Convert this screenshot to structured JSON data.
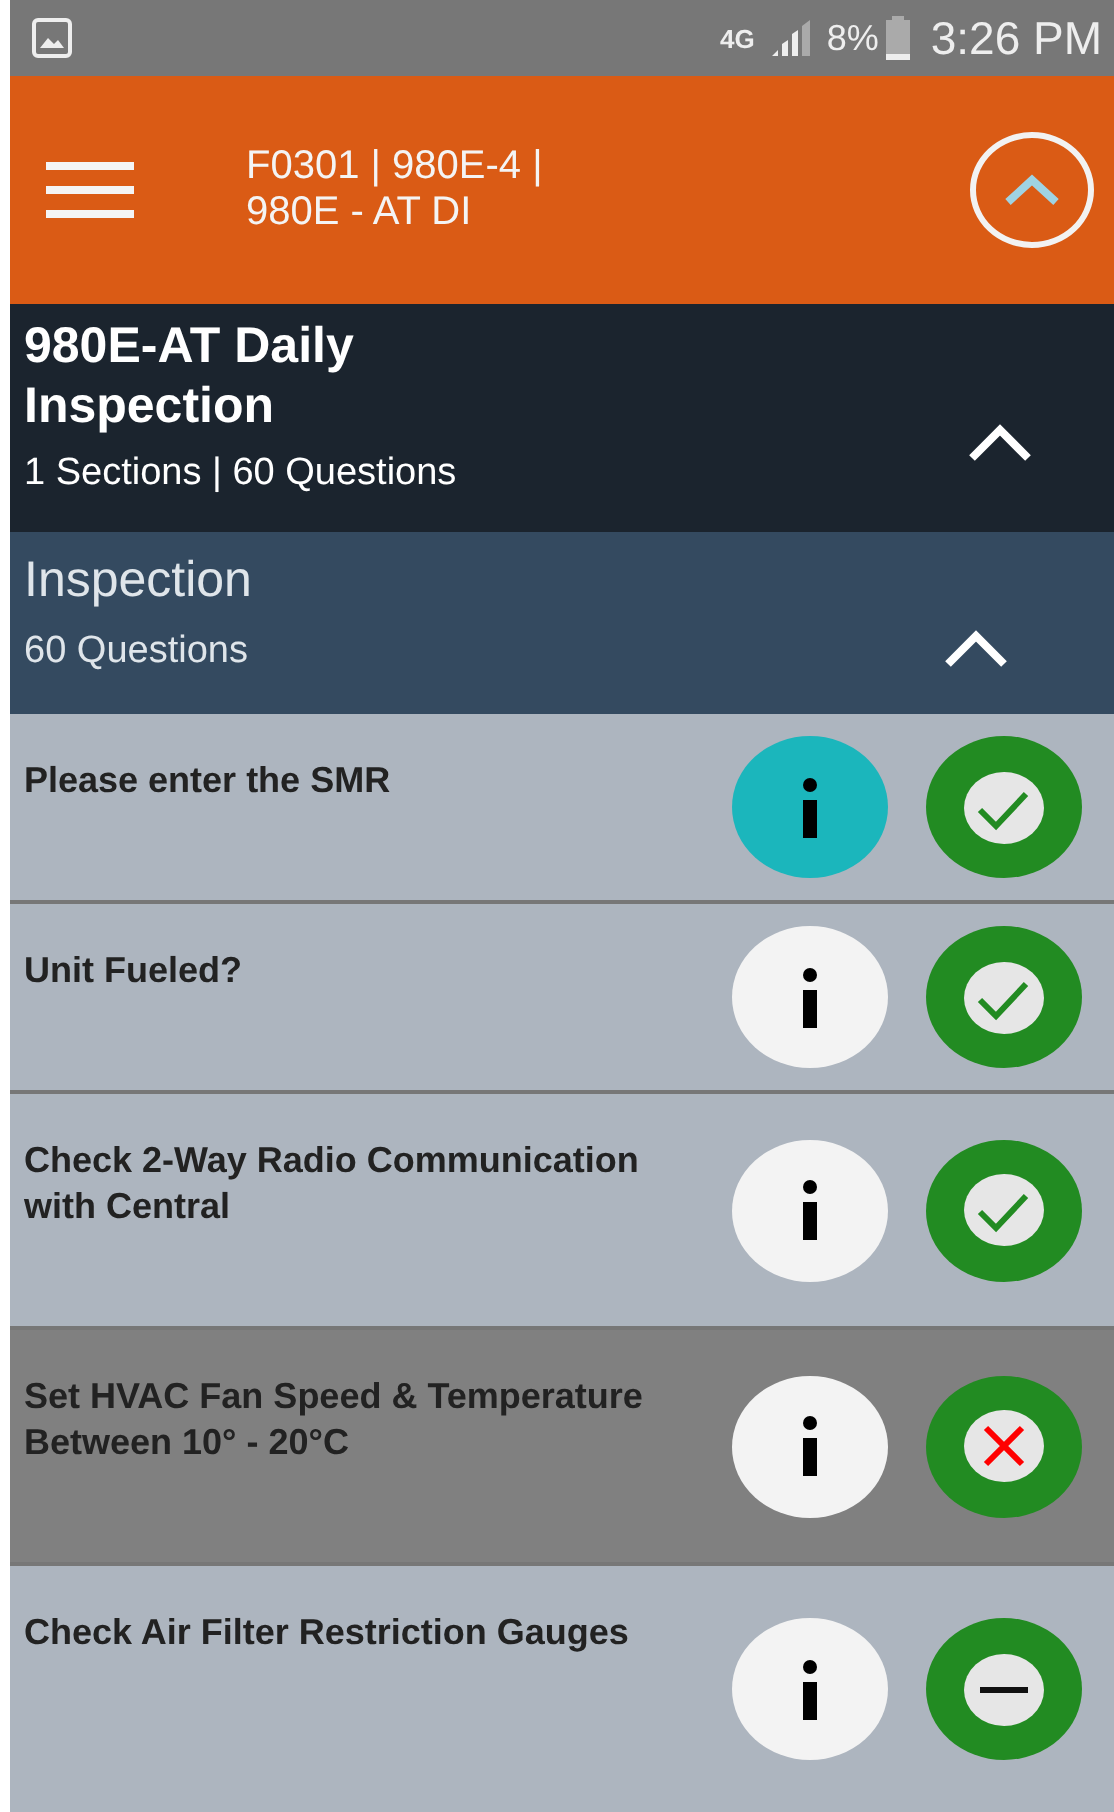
{
  "status_bar": {
    "network": "4G",
    "battery": "8%",
    "time": "3:26 PM"
  },
  "app_bar": {
    "title": "F0301 | 980E-4 | 980E - AT DI"
  },
  "checklist": {
    "title": "980E-AT Daily Inspection",
    "summary": "1 Sections | 60 Questions",
    "expanded": true
  },
  "section": {
    "title": "Inspection",
    "summary": "60 Questions",
    "expanded": true
  },
  "questions": [
    {
      "text": "Please enter the SMR",
      "selected": false,
      "info_active": true,
      "kind": "pass"
    },
    {
      "text": "Unit Fueled?",
      "selected": false,
      "info_active": false,
      "kind": "pass"
    },
    {
      "text": "Check 2-Way Radio Communication with Central",
      "selected": false,
      "info_active": false,
      "kind": "pass"
    },
    {
      "text": "Set HVAC Fan Speed & Temperature Between 10° - 20°C",
      "selected": true,
      "info_active": false,
      "kind": "fail"
    },
    {
      "text": "Check Air Filter Restriction Gauges",
      "selected": false,
      "info_active": false,
      "kind": "na"
    }
  ]
}
